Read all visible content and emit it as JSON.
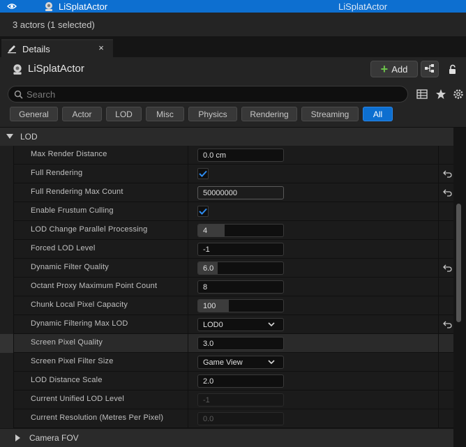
{
  "outliner": {
    "actor_name": "LiSplatActor",
    "actor_type": "LiSplatActor"
  },
  "status": {
    "text": "3 actors (1 selected)"
  },
  "tab": {
    "title": "Details",
    "close_glyph": "×"
  },
  "header": {
    "actor_name": "LiSplatActor",
    "add_label": "Add"
  },
  "search": {
    "placeholder": "Search"
  },
  "categories": [
    "General",
    "Actor",
    "LOD",
    "Misc",
    "Physics",
    "Rendering",
    "Streaming",
    "All"
  ],
  "active_category": "All",
  "sections": {
    "lod": "LOD",
    "camera_fov": "Camera FOV"
  },
  "properties": [
    {
      "label": "Max Render Distance",
      "value": "0.0 cm"
    },
    {
      "label": "Full Rendering",
      "checked": true
    },
    {
      "label": "Full Rendering Max Count",
      "value": "50000000"
    },
    {
      "label": "Enable Frustum Culling",
      "checked": true
    },
    {
      "label": "LOD Change Parallel Processing",
      "value": "4"
    },
    {
      "label": "Forced LOD Level",
      "value": "-1"
    },
    {
      "label": "Dynamic Filter Quality",
      "value": "6.0"
    },
    {
      "label": "Octant Proxy Maximum Point Count",
      "value": "8"
    },
    {
      "label": "Chunk Local Pixel Capacity",
      "value": "100"
    },
    {
      "label": "Dynamic Filtering Max LOD",
      "value": "LOD0"
    },
    {
      "label": "Screen Pixel Quality",
      "value": "3.0"
    },
    {
      "label": "Screen Pixel Filter Size",
      "value": "Game View"
    },
    {
      "label": "LOD Distance Scale",
      "value": "2.0"
    },
    {
      "label": "Current Unified LOD Level",
      "value": "-1"
    },
    {
      "label": "Current Resolution (Metres Per Pixel)",
      "value": "0.0"
    }
  ],
  "colors": {
    "accent": "#0d6fd0",
    "panel": "#242424",
    "add_plus": "#6cc24a"
  }
}
